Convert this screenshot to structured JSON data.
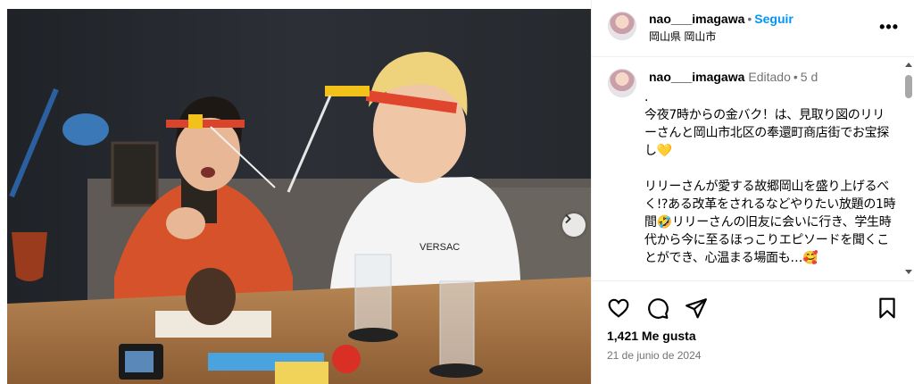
{
  "post": {
    "username": "nao___imagawa",
    "follow_label": "Seguir",
    "location": "岡山県 岡山市",
    "more_icon": "more-options-icon"
  },
  "caption": {
    "username": "nao___imagawa",
    "edited_label": "Editado",
    "time_ago": "5 d",
    "text": ".\n今夜7時からの金バク！は、見取り図のリリーさんと岡山市北区の奉還町商店街でお宝探し💛\n\nリリーさんが愛する故郷岡山を盛り上げるべく!?ある改革をされるなどやりたい放題の1時間🤣リリーさんの旧友に会いに行き、学生時代から今に至るほっこりエピソードを聞くことができ、心温まる場面も…🥰"
  },
  "media": {
    "shirt_text": "VERSAC"
  },
  "engagement": {
    "likes_text": "1,421 Me gusta",
    "date_text": "21 de junio de 2024"
  },
  "colors": {
    "link": "#0095f6",
    "muted": "#737373",
    "border": "#efefef"
  }
}
